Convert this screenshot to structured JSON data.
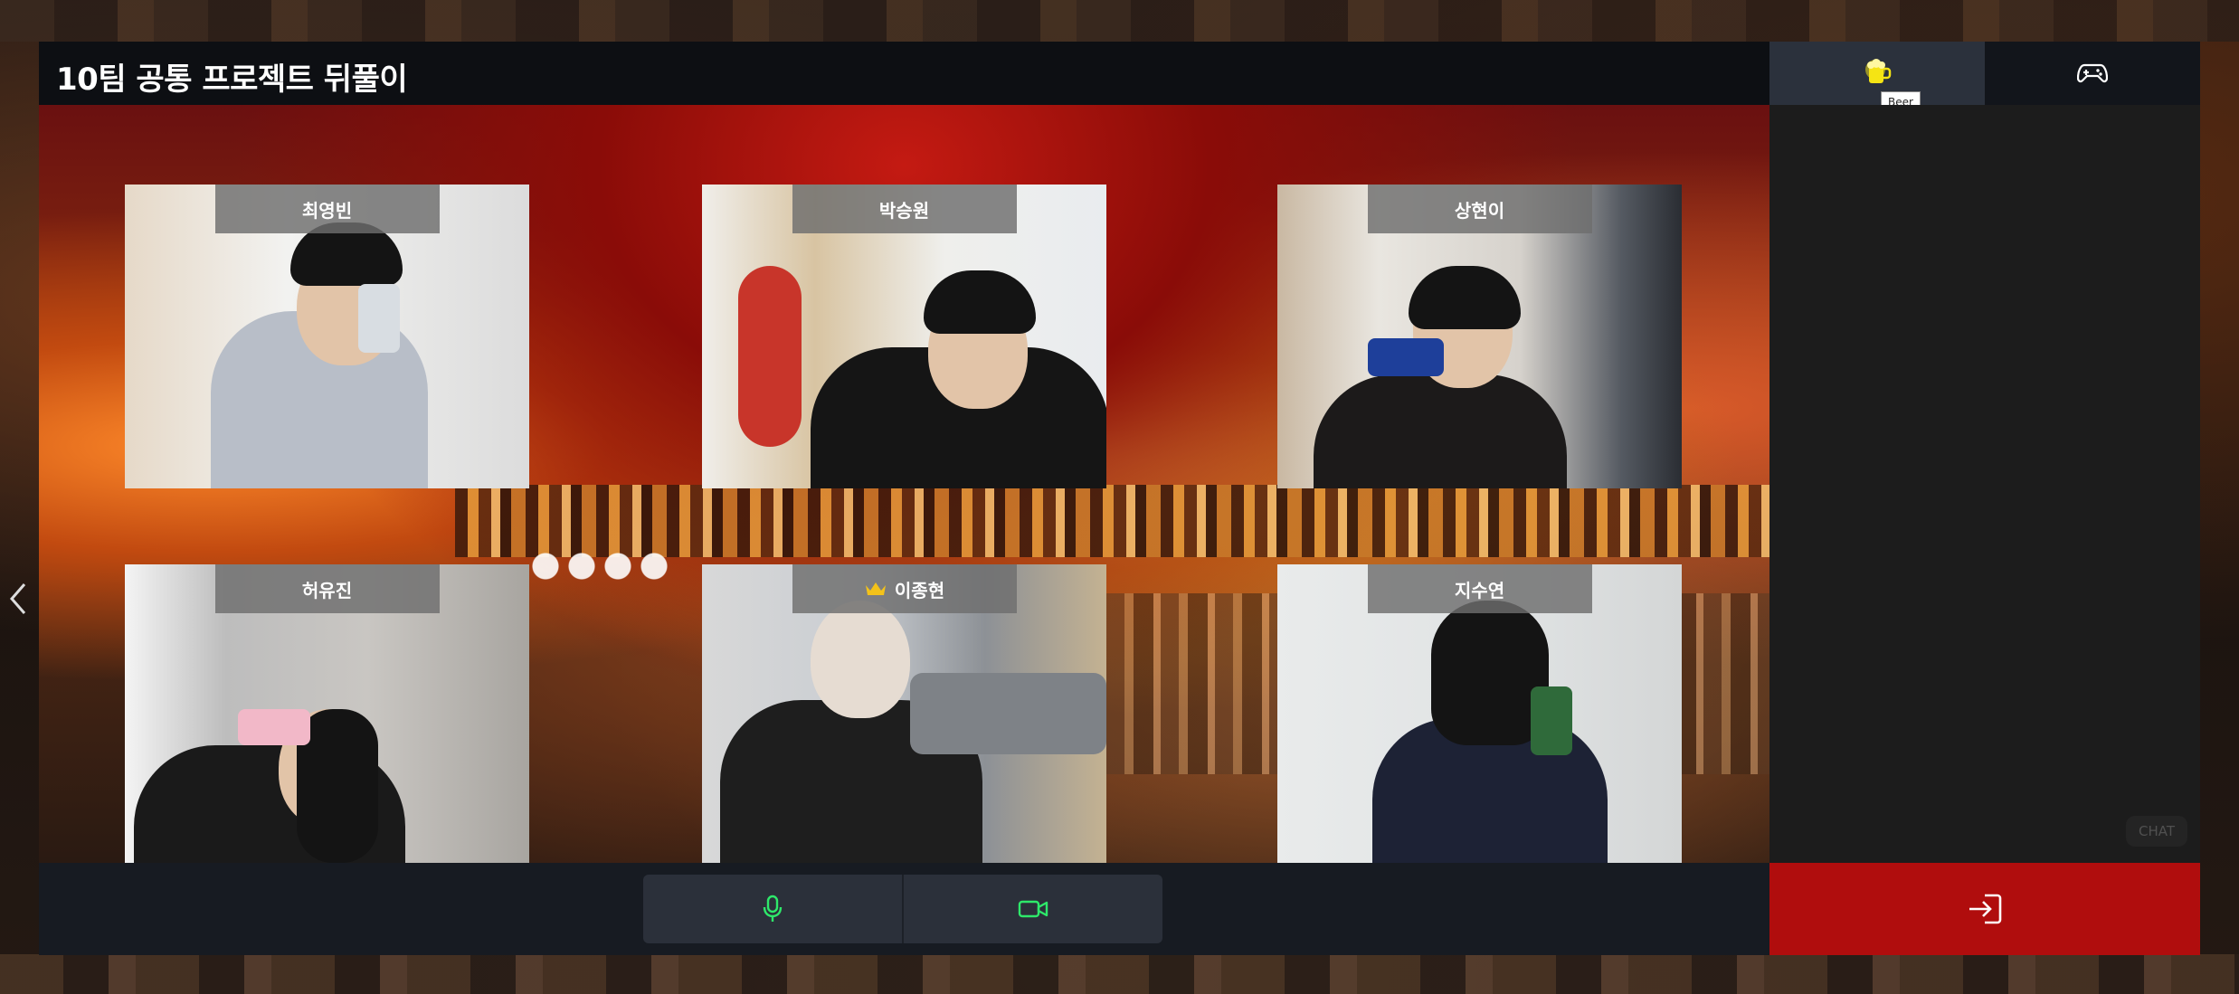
{
  "room": {
    "title": "10팀 공통 프로젝트 뒤풀이"
  },
  "participants": [
    {
      "name": "최영빈",
      "host": false
    },
    {
      "name": "박승원",
      "host": false
    },
    {
      "name": "상현이",
      "host": false
    },
    {
      "name": "허유진",
      "host": false
    },
    {
      "name": "이종현",
      "host": true
    },
    {
      "name": "지수연",
      "host": false
    }
  ],
  "controls": {
    "mic_icon": "microphone-icon",
    "camera_icon": "video-camera-icon"
  },
  "side_panel": {
    "tabs": [
      {
        "icon": "beer-icon",
        "tooltip": "Beer",
        "active": true
      },
      {
        "icon": "gamepad-icon",
        "active": false
      }
    ],
    "chat_label": "CHAT",
    "leave_icon": "exit-icon"
  },
  "colors": {
    "accent_green": "#2ee86a",
    "leave_red": "#b00d0d",
    "beer_yellow": "#f5e414",
    "crown_gold": "#f3c21a"
  }
}
